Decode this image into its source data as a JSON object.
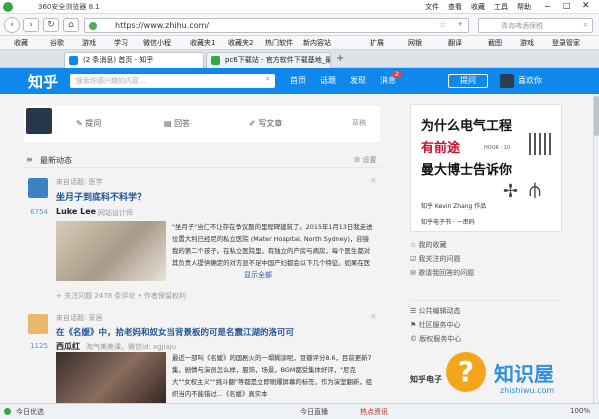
{
  "browser": {
    "title": "360安全浏览器 8.1",
    "menu": [
      "文件",
      "查看",
      "收藏",
      "工具",
      "帮助"
    ],
    "url": "https://www.zhihu.com/",
    "search_placeholder": "青岛啤酒保税",
    "favorites_label": "收藏",
    "bookmarks": [
      "谷歌",
      "游戏",
      "学习",
      "微信小程",
      "收藏夹1",
      "收藏夹2",
      "热门软件",
      "新内容站"
    ],
    "toolbar_right": [
      "扩展",
      "网银",
      "翻译",
      "截图",
      "游戏",
      "登录管家"
    ],
    "tabs": [
      "(2 条消息) 首页 - 知乎",
      "pc6下载站 - 官方软件下载基地_最安"
    ],
    "status_left": "今日优选",
    "status_items": [
      "今日直播",
      "热点资讯"
    ],
    "zoom": "100%"
  },
  "zhihu": {
    "logo": "知乎",
    "search_placeholder": "搜索你感兴趣的内容...",
    "nav": [
      "首页",
      "话题",
      "发现",
      "消息"
    ],
    "message_badge": "2",
    "ask_button": "提问",
    "username": "喜欢你"
  },
  "compose": {
    "ask": "提问",
    "answer": "回答",
    "write": "写文章",
    "drafts": "草稿"
  },
  "feed": {
    "title": "最新动态",
    "settings": "设置",
    "items": [
      {
        "source": "来自话题: 医学",
        "title": "坐月子到底科不科学？",
        "votes": "6754",
        "author": "Luke Lee",
        "author_desc": "网站设计师",
        "excerpt": "\"坐月子\"当仁不让存在争议题的里程碑建筑了。2015年1月13日我走进位置大利已经尼的私立医院 (Mater Hospital, North Sydney)，迎接我的第二个孩子。在私立医院里，有独立的产房与病房，每个医生都对其负责人提供确定的对方显不足中国产妇都会以下几个特征。如果在医院里看到",
        "more": "显示全部",
        "actions": "+ 关注问题   2478 条评论   • 作者保留权利"
      },
      {
        "source": "来自话题: 家居",
        "title": "在《名媛》中，拾老妈和奴女当背景板的可是名震江湖的洛可可",
        "votes": "1125",
        "author": "西瓜红",
        "author_desc": "淘气美美课，微信id: xgjiaju",
        "excerpt": "最近一部叫《名媛》的国剧火的一塌糊涂呢，豆瓣评分8.6，目前更新7集，剧情与演员怎么样，服饰，场景，BGM都受集体好评，\"尼克大\"\"女权主义\"\"挑斗翻\"等都是立即刷爆屏幕的标签，作为演室翻新，组织当内不能错过...《名媛》真实本"
      }
    ]
  },
  "sidebar": {
    "ad_lines": [
      "为什么电气工程",
      "有前途",
      "曼大博士告诉你"
    ],
    "ad_author": "知乎 Kevin Zhang 作品",
    "ad_footer": "知乎电子书 · 一串码",
    "ad_badge": "HOUR : 10",
    "links": [
      "我的收藏",
      "我关注的问题",
      "邀请我回答的问题"
    ],
    "links2": [
      "公共编辑动态",
      "社区服务中心",
      "版权服务中心"
    ],
    "bottom": "知乎电子"
  },
  "watermark": {
    "brand": "知识屋",
    "url": "zhishiwu.com"
  }
}
